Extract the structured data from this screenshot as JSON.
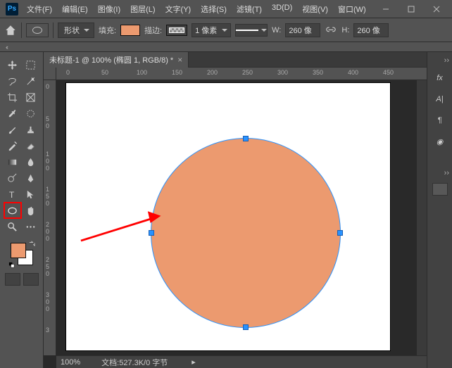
{
  "app": {
    "logo_text": "Ps"
  },
  "menu": {
    "file": "文件(F)",
    "edit": "编辑(E)",
    "image": "图像(I)",
    "layer": "图层(L)",
    "type": "文字(Y)",
    "select": "选择(S)",
    "filter": "滤镜(T)",
    "three_d": "3D(D)",
    "view": "视图(V)",
    "window": "窗口(W)"
  },
  "options": {
    "mode_label": "形状",
    "fill_label": "填充:",
    "fill_color": "#ec9a6f",
    "stroke_label": "描边:",
    "stroke_width": "1 像素",
    "w_label": "W:",
    "w_value": "260 像",
    "h_label": "H:",
    "h_value": "260 像"
  },
  "document": {
    "tab_title": "未标题-1 @ 100% (椭圆 1, RGB/8) *",
    "zoom": "100%",
    "status": "文档:527.3K/0 字节"
  },
  "ruler_h": [
    "0",
    "50",
    "100",
    "150",
    "200",
    "250",
    "300",
    "350",
    "400",
    "450"
  ],
  "ruler_v": [
    "0",
    "0",
    "5",
    "0",
    "1",
    "0",
    "0",
    "1",
    "5",
    "0",
    "2",
    "0",
    "0",
    "2",
    "5",
    "0",
    "3",
    "0",
    "0",
    "3"
  ],
  "colors": {
    "fg": "#ec9a6f",
    "accent": "#2892ff",
    "shape_fill": "#ec9a6f"
  },
  "right_panel_icons": [
    "fx",
    "A|",
    "¶",
    "◉"
  ],
  "annotation": {
    "type": "arrow",
    "color": "#ff0000"
  }
}
